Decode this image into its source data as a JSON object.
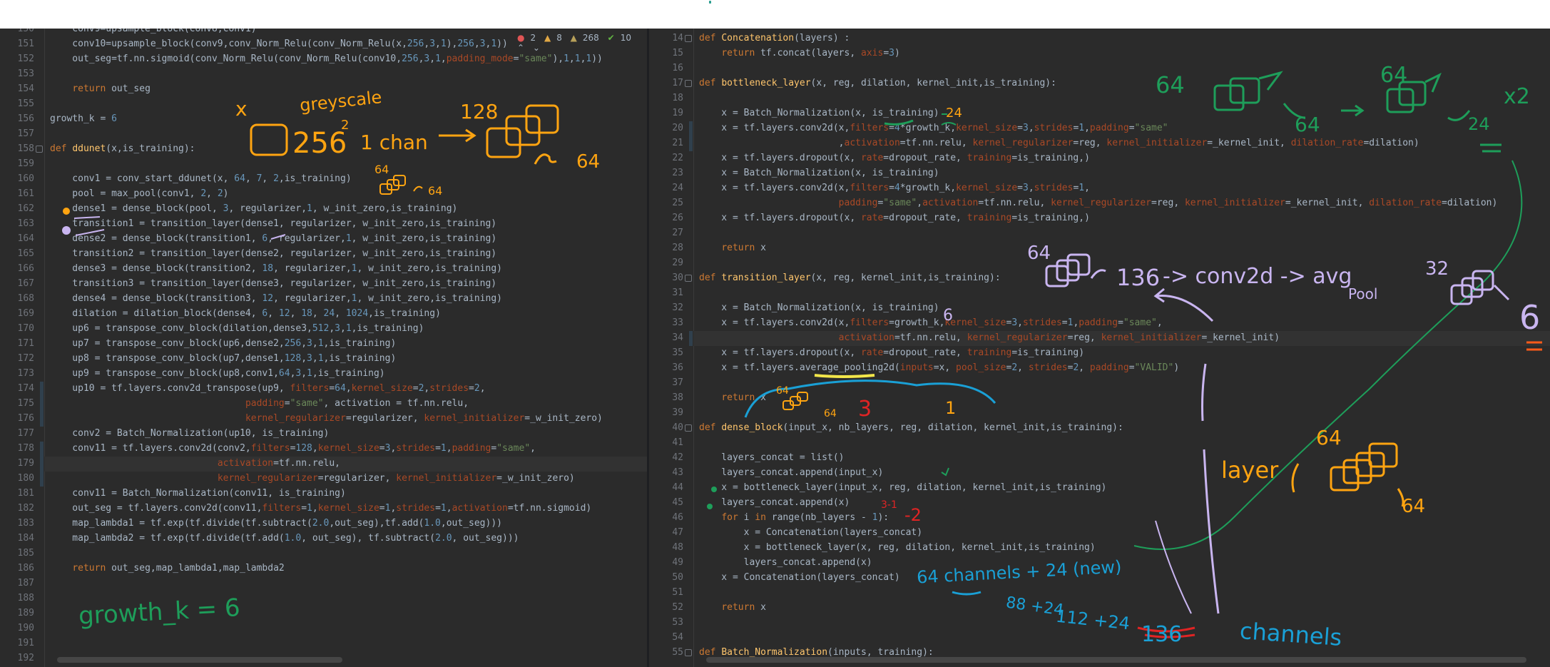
{
  "left_editor": {
    "inspection": {
      "errors": "2",
      "warnings": "8",
      "weak_warnings": "268",
      "typos": "10"
    },
    "lines": [
      {
        "n": "150",
        "t": "    conv9=upsample_block(conv8,conv1)"
      },
      {
        "n": "151",
        "t": "    conv10=upsample_block(conv9,conv_Norm_Relu(conv_Norm_Relu(x,256,3,1),256,3,1))"
      },
      {
        "n": "152",
        "t": "    out_seg=tf.nn.sigmoid(conv_Norm_Relu(conv_Norm_Relu(conv10,256,3,1,padding_mode=\"same\"),1,1,1))"
      },
      {
        "n": "153",
        "t": ""
      },
      {
        "n": "154",
        "t": "    return out_seg"
      },
      {
        "n": "155",
        "t": ""
      },
      {
        "n": "156",
        "t": "growth_k = 6"
      },
      {
        "n": "157",
        "t": ""
      },
      {
        "n": "158",
        "t": "def ddunet(x,is_training):"
      },
      {
        "n": "159",
        "t": ""
      },
      {
        "n": "160",
        "t": "    conv1 = conv_start_ddunet(x, 64, 7, 2,is_training)"
      },
      {
        "n": "161",
        "t": "    pool = max_pool(conv1, 2, 2)"
      },
      {
        "n": "162",
        "t": "    dense1 = dense_block(pool, 3, regularizer,1, w_init_zero,is_training)"
      },
      {
        "n": "163",
        "t": "    transition1 = transition_layer(dense1, regularizer, w_init_zero,is_training)"
      },
      {
        "n": "164",
        "t": "    dense2 = dense_block(transition1, 6, regularizer,1, w_init_zero,is_training)"
      },
      {
        "n": "165",
        "t": "    transition2 = transition_layer(dense2, regularizer, w_init_zero,is_training)"
      },
      {
        "n": "166",
        "t": "    dense3 = dense_block(transition2, 18, regularizer,1, w_init_zero,is_training)"
      },
      {
        "n": "167",
        "t": "    transition3 = transition_layer(dense3, regularizer, w_init_zero,is_training)"
      },
      {
        "n": "168",
        "t": "    dense4 = dense_block(transition3, 12, regularizer,1, w_init_zero,is_training)"
      },
      {
        "n": "169",
        "t": "    dilation = dilation_block(dense4, 6, 12, 18, 24, 1024,is_training)"
      },
      {
        "n": "170",
        "t": "    up6 = transpose_conv_block(dilation,dense3,512,3,1,is_training)"
      },
      {
        "n": "171",
        "t": "    up7 = transpose_conv_block(up6,dense2,256,3,1,is_training)"
      },
      {
        "n": "172",
        "t": "    up8 = transpose_conv_block(up7,dense1,128,3,1,is_training)"
      },
      {
        "n": "173",
        "t": "    up9 = transpose_conv_block(up8,conv1,64,3,1,is_training)"
      },
      {
        "n": "174",
        "t": "    up10 = tf.layers.conv2d_transpose(up9, filters=64,kernel_size=2,strides=2,"
      },
      {
        "n": "175",
        "t": "                                   padding=\"same\", activation = tf.nn.relu,"
      },
      {
        "n": "176",
        "t": "                                   kernel_regularizer=regularizer, kernel_initializer=_w_init_zero)"
      },
      {
        "n": "177",
        "t": "    conv2 = Batch_Normalization(up10, is_training)"
      },
      {
        "n": "178",
        "t": "    conv11 = tf.layers.conv2d(conv2,filters=128,kernel_size=3,strides=1,padding=\"same\","
      },
      {
        "n": "179",
        "t": "                              activation=tf.nn.relu,"
      },
      {
        "n": "180",
        "t": "                              kernel_regularizer=regularizer, kernel_initializer=_w_init_zero)"
      },
      {
        "n": "181",
        "t": "    conv11 = Batch_Normalization(conv11, is_training)"
      },
      {
        "n": "182",
        "t": "    out_seg = tf.layers.conv2d(conv11,filters=1,kernel_size=1,strides=1,activation=tf.nn.sigmoid)"
      },
      {
        "n": "183",
        "t": "    map_lambda1 = tf.exp(tf.divide(tf.subtract(2.0,out_seg),tf.add(1.0,out_seg)))"
      },
      {
        "n": "184",
        "t": "    map_lambda2 = tf.exp(tf.divide(tf.add(1.0, out_seg), tf.subtract(2.0, out_seg)))"
      },
      {
        "n": "185",
        "t": ""
      },
      {
        "n": "186",
        "t": "    return out_seg,map_lambda1,map_lambda2"
      },
      {
        "n": "187",
        "t": ""
      },
      {
        "n": "188",
        "t": ""
      },
      {
        "n": "189",
        "t": ""
      },
      {
        "n": "190",
        "t": ""
      },
      {
        "n": "191",
        "t": ""
      },
      {
        "n": "192",
        "t": ""
      }
    ]
  },
  "right_editor": {
    "lines": [
      {
        "n": "14",
        "t": "def Concatenation(layers) :"
      },
      {
        "n": "15",
        "t": "    return tf.concat(layers, axis=3)"
      },
      {
        "n": "16",
        "t": ""
      },
      {
        "n": "17",
        "t": "def bottleneck_layer(x, reg, dilation, kernel_init,is_training):"
      },
      {
        "n": "18",
        "t": ""
      },
      {
        "n": "19",
        "t": "    x = Batch_Normalization(x, is_training)"
      },
      {
        "n": "20",
        "t": "    x = tf.layers.conv2d(x,filters=4*growth_k,kernel_size=3,strides=1,padding=\"same\""
      },
      {
        "n": "21",
        "t": "                         ,activation=tf.nn.relu, kernel_regularizer=reg, kernel_initializer=_kernel_init, dilation_rate=dilation)"
      },
      {
        "n": "22",
        "t": "    x = tf.layers.dropout(x, rate=dropout_rate, training=is_training,)"
      },
      {
        "n": "23",
        "t": "    x = Batch_Normalization(x, is_training)"
      },
      {
        "n": "24",
        "t": "    x = tf.layers.conv2d(x,filters=4*growth_k,kernel_size=3,strides=1,"
      },
      {
        "n": "25",
        "t": "                         padding=\"same\",activation=tf.nn.relu, kernel_regularizer=reg, kernel_initializer=_kernel_init, dilation_rate=dilation)"
      },
      {
        "n": "26",
        "t": "    x = tf.layers.dropout(x, rate=dropout_rate, training=is_training,)"
      },
      {
        "n": "27",
        "t": ""
      },
      {
        "n": "28",
        "t": "    return x"
      },
      {
        "n": "29",
        "t": ""
      },
      {
        "n": "30",
        "t": "def transition_layer(x, reg, kernel_init,is_training):"
      },
      {
        "n": "31",
        "t": ""
      },
      {
        "n": "32",
        "t": "    x = Batch_Normalization(x, is_training)"
      },
      {
        "n": "33",
        "t": "    x = tf.layers.conv2d(x,filters=growth_k,kernel_size=3,strides=1,padding=\"same\","
      },
      {
        "n": "34",
        "t": "                         activation=tf.nn.relu, kernel_regularizer=reg, kernel_initializer=_kernel_init)"
      },
      {
        "n": "35",
        "t": "    x = tf.layers.dropout(x, rate=dropout_rate, training=is_training)"
      },
      {
        "n": "36",
        "t": "    x = tf.layers.average_pooling2d(inputs=x, pool_size=2, strides=2, padding=\"VALID\")"
      },
      {
        "n": "37",
        "t": ""
      },
      {
        "n": "38",
        "t": "    return x"
      },
      {
        "n": "39",
        "t": ""
      },
      {
        "n": "40",
        "t": "def dense_block(input_x, nb_layers, reg, dilation, kernel_init,is_training):"
      },
      {
        "n": "41",
        "t": ""
      },
      {
        "n": "42",
        "t": "    layers_concat = list()"
      },
      {
        "n": "43",
        "t": "    layers_concat.append(input_x)"
      },
      {
        "n": "44",
        "t": "    x = bottleneck_layer(input_x, reg, dilation, kernel_init,is_training)"
      },
      {
        "n": "45",
        "t": "    layers_concat.append(x)"
      },
      {
        "n": "46",
        "t": "    for i in range(nb_layers - 1):"
      },
      {
        "n": "47",
        "t": "        x = Concatenation(layers_concat)"
      },
      {
        "n": "48",
        "t": "        x = bottleneck_layer(x, reg, dilation, kernel_init,is_training)"
      },
      {
        "n": "49",
        "t": "        layers_concat.append(x)"
      },
      {
        "n": "50",
        "t": "    x = Concatenation(layers_concat)"
      },
      {
        "n": "51",
        "t": ""
      },
      {
        "n": "52",
        "t": "    return x"
      },
      {
        "n": "53",
        "t": ""
      },
      {
        "n": "54",
        "t": ""
      },
      {
        "n": "55",
        "t": "def Batch_Normalization(inputs, training):"
      }
    ]
  },
  "annotations": {
    "grayscale": "greyscale",
    "x_mark": "x",
    "size_256": "256",
    "sq2": "2",
    "one_chan": "1 chan",
    "arrow": "->",
    "size_128": "128",
    "ch64_left": "64",
    "small_64sq": "64",
    "small_64": "64",
    "growth_k_note": "growth_k = 6",
    "bn_24": "24",
    "top_64sq": "64",
    "top_64": "64",
    "arrow_right_top": "->",
    "right_64sq": "64",
    "ch_24": "24",
    "x2": "x2",
    "trans_64sq": "64",
    "trans_136": "136",
    "conv2d_note": "-> conv2d -> avg",
    "pool_note": "Pool",
    "size_32sq": "32",
    "six": "6",
    "ret_64": "64",
    "ret_64b": "64",
    "three": "3",
    "one": "1",
    "minus2": "-2",
    "three_minus_one": "3-1",
    "layer_note": "layer",
    "layer_64sq": "64",
    "layer_64": "64",
    "channels_note": "64 channels + 24 (new)",
    "eighty_eight": "88 +24",
    "one_twelve": "112 +24",
    "one_thirty_six": "136",
    "channels_word": "channels"
  },
  "colors": {
    "orange_ink": "#ffa411",
    "green_ink": "#1e9e5a",
    "lilac_ink": "#c9b5f0",
    "blue_ink": "#1aa0d6",
    "red_ink": "#e02424",
    "yellow_ink": "#f2e64a",
    "editor_bg": "#2b2b2b",
    "keyword": "#cc7832",
    "function": "#ffc66d",
    "string": "#6a8759",
    "number": "#6897bb"
  }
}
